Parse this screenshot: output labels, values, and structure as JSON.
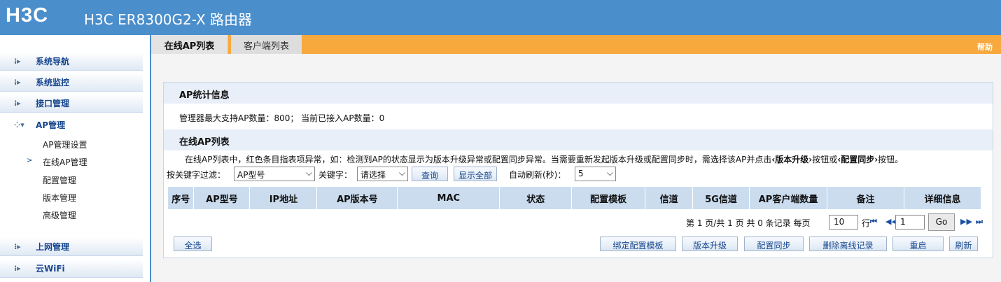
{
  "header": {
    "logo": "H3C",
    "title": "H3C ER8300G2-X 路由器"
  },
  "sidebar": {
    "groups": [
      {
        "label": "系统导航",
        "icon": "expand-icon"
      },
      {
        "label": "系统监控",
        "icon": "expand-icon"
      },
      {
        "label": "接口管理",
        "icon": "expand-icon"
      },
      {
        "label": "AP管理",
        "icon": "collapse-icon"
      },
      {
        "label": "上网管理",
        "icon": "expand-icon"
      },
      {
        "label": "云WiFi",
        "icon": "expand-icon"
      }
    ],
    "ap_sub_items": [
      "AP管理设置",
      "在线AP管理",
      "配置管理",
      "版本管理",
      "高级管理"
    ],
    "active_sub_item": "在线AP管理"
  },
  "tabs": [
    {
      "label": "在线AP列表",
      "active": true
    },
    {
      "label": "客户端列表",
      "active": false
    }
  ],
  "help_label": "帮助",
  "stats": {
    "heading": "AP统计信息",
    "text": "管理器最大支持AP数量：800； 当前已接入AP数量：0"
  },
  "online_list": {
    "heading": "在线AP列表",
    "description_prefix": "在线AP列表中，红色条目指表项异常，如：检测到AP的状态显示为版本升级异常或配置同步异常。当需要重新发起版本升级或配置同步时，需选择该AP并点击",
    "upgrade_bold": "‹版本升级›",
    "description_mid": "按钮或",
    "sync_bold": "‹配置同步›",
    "description_suffix": "按钮。"
  },
  "filter": {
    "keyword_filter_label": "按关键字过滤：",
    "keyword_filter_value": "AP型号",
    "keyword_label": "关键字：",
    "keyword_value": "请选择",
    "query_button": "查询",
    "show_all_button": "显示全部",
    "refresh_label": "自动刷新(秒)：",
    "refresh_value": "5"
  },
  "table": {
    "columns": [
      "序号",
      "AP型号",
      "IP地址",
      "AP版本号",
      "MAC",
      "状态",
      "配置模板",
      "信道",
      "5G信道",
      "AP客户端数量",
      "备注",
      "详细信息"
    ]
  },
  "pager": {
    "summary": "第 1 页/共 1 页 共 0 条记录 每页",
    "per_page": "10",
    "row_unit": "行",
    "page_input": "1",
    "go_label": "Go"
  },
  "actions": {
    "select_all": "全选",
    "bind_template": "绑定配置模板",
    "upgrade": "版本升级",
    "sync": "配置同步",
    "delete_offline": "删除离线记录",
    "reboot": "重启",
    "refresh": "刷新"
  },
  "colors": {
    "header_bg": "#4a8ecc",
    "tab_bar_bg": "#f7a93e",
    "table_header_bg": "#cbdcef",
    "link_blue": "#18478f"
  }
}
